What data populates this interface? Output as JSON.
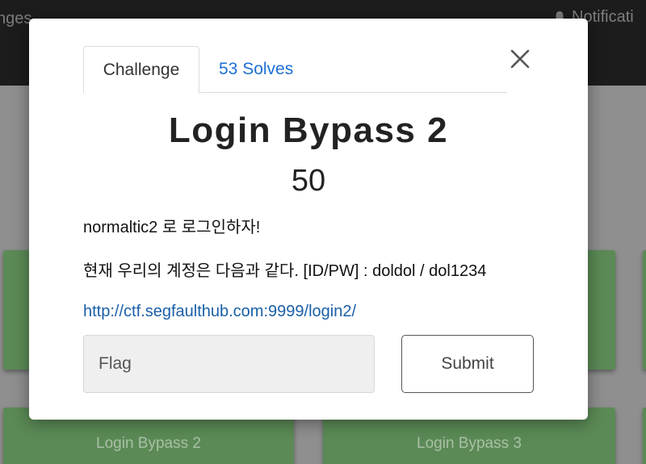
{
  "background": {
    "nav_left_text": "nges",
    "nav_right_text": "Notificati",
    "cards": [
      {
        "label": ""
      },
      {
        "label": ""
      },
      {
        "label": ""
      },
      {
        "label": "Login Bypass 2"
      },
      {
        "label": "Login Bypass 3"
      },
      {
        "label": ""
      }
    ]
  },
  "modal": {
    "tabs": [
      {
        "label": "Challenge"
      },
      {
        "label": "53 Solves"
      }
    ],
    "close_symbol": "×",
    "challenge_name": "Login Bypass 2",
    "challenge_value": "50",
    "description_lines": [
      "normaltic2 로 로그인하자!",
      "현재 우리의 계정은 다음과 같다. [ID/PW] : doldol / dol1234"
    ],
    "link_text": "http://ctf.segfaulthub.com:9999/login2/",
    "flag_placeholder": "Flag",
    "flag_value": "",
    "submit_label": "Submit"
  },
  "colors": {
    "navbar": "#1c1c1c",
    "card": "#5b8a56",
    "link": "#1a5fa8",
    "tab_link": "#1d6fd6"
  },
  "icons": [
    "bell-icon",
    "close-icon"
  ]
}
